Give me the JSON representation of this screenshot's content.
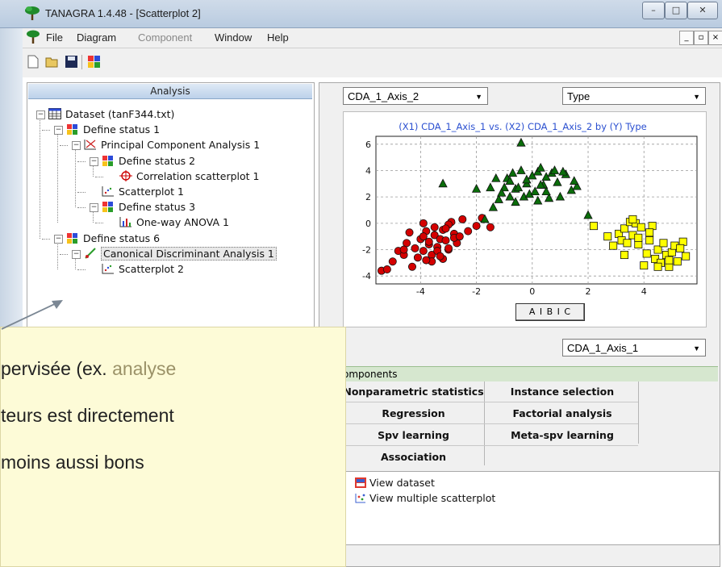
{
  "window": {
    "title": "TANAGRA 1.4.48 - [Scatterplot 2]",
    "min_label": "–",
    "max_label": "□",
    "close_label": "✕"
  },
  "menu": [
    "File",
    "Diagram",
    "Component",
    "Window",
    "Help"
  ],
  "analysis": {
    "header": "Analysis",
    "tree": [
      {
        "label": "Dataset (tanF344.txt)",
        "icon": "table-icon",
        "level": 0,
        "expander": "minus"
      },
      {
        "label": "Define status 1",
        "icon": "define-status-icon",
        "level": 1,
        "expander": "minus"
      },
      {
        "label": "Principal Component Analysis 1",
        "icon": "pca-icon",
        "level": 2,
        "expander": "minus"
      },
      {
        "label": "Define status 2",
        "icon": "define-status-icon",
        "level": 3,
        "expander": "minus"
      },
      {
        "label": "Correlation scatterplot 1",
        "icon": "crosshair-icon",
        "level": 4,
        "expander": "none"
      },
      {
        "label": "Scatterplot 1",
        "icon": "scatterplot-icon",
        "level": 3,
        "expander": "none"
      },
      {
        "label": "Define status 3",
        "icon": "define-status-icon",
        "level": 3,
        "expander": "minus"
      },
      {
        "label": "One-way ANOVA 1",
        "icon": "anova-icon",
        "level": 4,
        "expander": "none"
      },
      {
        "label": "Define status 6",
        "icon": "define-status-icon",
        "level": 1,
        "expander": "minus"
      },
      {
        "label": "Canonical Discriminant Analysis 1",
        "icon": "cda-icon",
        "level": 2,
        "expander": "minus",
        "selected": true
      },
      {
        "label": "Scatterplot 2",
        "icon": "scatterplot-icon",
        "level": 3,
        "expander": "none"
      }
    ]
  },
  "plot": {
    "y_select": "CDA_1_Axis_2",
    "color_select": "Type",
    "x_select": "CDA_1_Axis_1",
    "legend_button": "A I B I C",
    "colors": {
      "red": "#d40000",
      "green": "#0a6d0a",
      "yellow": "#ffff00"
    }
  },
  "chart_data": {
    "type": "scatter",
    "title": "(X1) CDA_1_Axis_1 vs. (X2) CDA_1_Axis_2 by (Y) Type",
    "xlim": [
      -5.6,
      5.9
    ],
    "ylim": [
      -4.6,
      6.6
    ],
    "xticks": [
      "-4",
      "-2",
      "0",
      "2",
      "4"
    ],
    "xtick_values": [
      -4,
      -2,
      0,
      2,
      4
    ],
    "yticks": [
      "6",
      "4",
      "2",
      "0",
      "-2",
      "-4"
    ],
    "ytick_values": [
      6,
      4,
      2,
      0,
      -2,
      -4
    ],
    "grid": true,
    "series": [
      {
        "marker": "circle",
        "color": "#d40000",
        "x": [
          -5.4,
          -5.2,
          -5.0,
          -4.8,
          -4.6,
          -4.5,
          -4.3,
          -4.2,
          -4.1,
          -4.0,
          -3.9,
          -3.8,
          -3.7,
          -3.6,
          -3.5,
          -3.4,
          -3.3,
          -3.2,
          -3.1,
          -3.0,
          -2.9,
          -2.8,
          -2.7,
          -2.5,
          -2.3,
          -2.0,
          -1.8,
          -1.5,
          -3.9,
          -3.6,
          -3.4,
          -3.2,
          -3.0,
          -2.8,
          -3.7,
          -3.5,
          -3.3,
          -4.4,
          -3.9,
          -3.0,
          -2.6,
          -4.6,
          -3.8,
          -3.1
        ],
        "y": [
          -3.6,
          -3.5,
          -2.9,
          -2.1,
          -2.4,
          -1.5,
          -3.3,
          -1.9,
          -2.6,
          -1.2,
          -2.1,
          -0.6,
          -1.6,
          -2.4,
          -0.9,
          -1.8,
          -1.2,
          -0.5,
          -1.3,
          -2.0,
          0.1,
          -0.8,
          -1.5,
          0.3,
          -0.6,
          -0.2,
          0.4,
          -0.3,
          -1.0,
          -2.9,
          -2.1,
          -2.7,
          -1.9,
          -1.1,
          -1.4,
          -0.3,
          -2.5,
          -0.7,
          0.0,
          -0.1,
          -1.0,
          -2.0,
          -2.8,
          -0.4
        ]
      },
      {
        "marker": "triangle",
        "color": "#0a6d0a",
        "x": [
          -3.2,
          -2.0,
          -1.7,
          -1.5,
          -1.3,
          -1.2,
          -1.0,
          -0.9,
          -0.8,
          -0.7,
          -0.6,
          -0.5,
          -0.4,
          -0.3,
          -0.2,
          -0.1,
          0.0,
          0.1,
          0.2,
          0.3,
          0.4,
          0.5,
          0.6,
          0.7,
          0.9,
          1.0,
          1.2,
          1.4,
          1.6,
          2.0,
          -0.4,
          -1.1,
          0.8,
          -0.6,
          0.2,
          1.5,
          -1.4,
          -0.2,
          0.5,
          1.1,
          -0.8,
          0.3
        ],
        "y": [
          3.0,
          2.6,
          0.3,
          2.7,
          3.4,
          1.8,
          2.7,
          3.4,
          2.0,
          3.8,
          2.6,
          2.7,
          4.0,
          2.0,
          3.0,
          2.2,
          3.6,
          2.4,
          3.9,
          4.2,
          2.9,
          3.5,
          1.9,
          3.8,
          3.1,
          2.0,
          3.7,
          2.5,
          2.8,
          0.6,
          6.1,
          2.3,
          4.0,
          1.6,
          1.7,
          3.2,
          1.2,
          3.3,
          2.4,
          3.9,
          3.2,
          2.9
        ]
      },
      {
        "marker": "square",
        "color": "#ffff00",
        "x": [
          2.2,
          2.7,
          2.9,
          3.1,
          3.2,
          3.3,
          3.4,
          3.5,
          3.6,
          3.7,
          3.8,
          3.9,
          4.0,
          4.1,
          4.2,
          4.3,
          4.4,
          4.5,
          4.6,
          4.7,
          4.8,
          4.9,
          5.0,
          5.1,
          5.2,
          5.4,
          5.5,
          3.3,
          3.6,
          4.2,
          4.5,
          4.9,
          5.3,
          3.8
        ],
        "y": [
          -0.2,
          -1.0,
          -1.7,
          -0.8,
          -1.3,
          -0.4,
          -1.5,
          0.1,
          -0.9,
          0.0,
          -1.6,
          -0.3,
          -3.2,
          -2.3,
          -1.3,
          -0.2,
          -2.7,
          -2.0,
          -3.0,
          -1.5,
          -2.4,
          -3.3,
          -2.2,
          -1.7,
          -2.9,
          -1.4,
          -2.5,
          -2.4,
          0.3,
          -0.7,
          -3.3,
          -2.8,
          -1.9,
          -1.1
        ]
      }
    ]
  },
  "components": {
    "header": "omponents",
    "tabs": [
      [
        "Nonparametric statistics",
        "Instance selection"
      ],
      [
        "Regression",
        "Factorial analysis"
      ],
      [
        "Spv learning",
        "Meta-spv learning"
      ],
      [
        "Association",
        ""
      ]
    ]
  },
  "views": [
    {
      "label": "View dataset",
      "icon": "view-dataset-icon"
    },
    {
      "label": "View multiple scatterplot",
      "icon": "view-scatter-icon"
    }
  ],
  "overlay": {
    "lines": [
      {
        "pre": "pervisée (ex. ",
        "accent": "analyse"
      },
      {
        "pre": "teurs est directement",
        "accent": ""
      },
      {
        "pre": "moins aussi bons",
        "accent": ""
      }
    ],
    "accent_color": "#9b9268"
  }
}
